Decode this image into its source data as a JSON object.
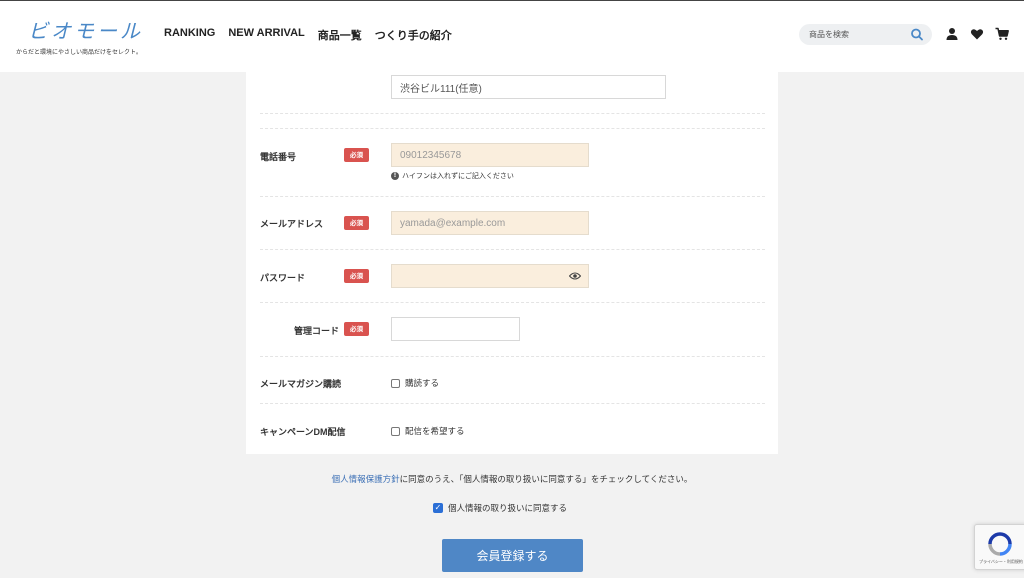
{
  "header": {
    "logo_text": "ビオモール",
    "logo_tagline": "からだと環境にやさしい商品だけをセレクト。",
    "nav": [
      "RANKING",
      "NEW ARRIVAL",
      "商品一覧",
      "つくり手の紹介"
    ],
    "search_placeholder": "商品を検索"
  },
  "form": {
    "address2_value": "渋谷ビル111(任意)",
    "required_badge": "必須",
    "phone": {
      "label": "電話番号",
      "placeholder": "09012345678",
      "hint": "ハイフンは入れずにご記入ください"
    },
    "email": {
      "label": "メールアドレス",
      "placeholder": "yamada@example.com"
    },
    "password": {
      "label": "パスワード",
      "placeholder": ""
    },
    "admin_code": {
      "label": "管理コード",
      "value": ""
    },
    "newsletter": {
      "label": "メールマガジン購読",
      "option": "購読する",
      "checked": false
    },
    "campaign": {
      "label": "キャンペーンDM配信",
      "option": "配信を希望する",
      "checked": false
    }
  },
  "consent": {
    "link_text": "個人情報保護方針",
    "text": "に同意のうえ、「個人情報の取り扱いに同意する」をチェックしてください。",
    "agree_label": "個人情報の取り扱いに同意する",
    "agree_checked": true
  },
  "submit_label": "会員登録する",
  "recaptcha_text": "プライバシー・利用規約",
  "colors": {
    "accent": "#4f87c6",
    "required": "#d9534f",
    "field_tint": "#faeedd"
  }
}
